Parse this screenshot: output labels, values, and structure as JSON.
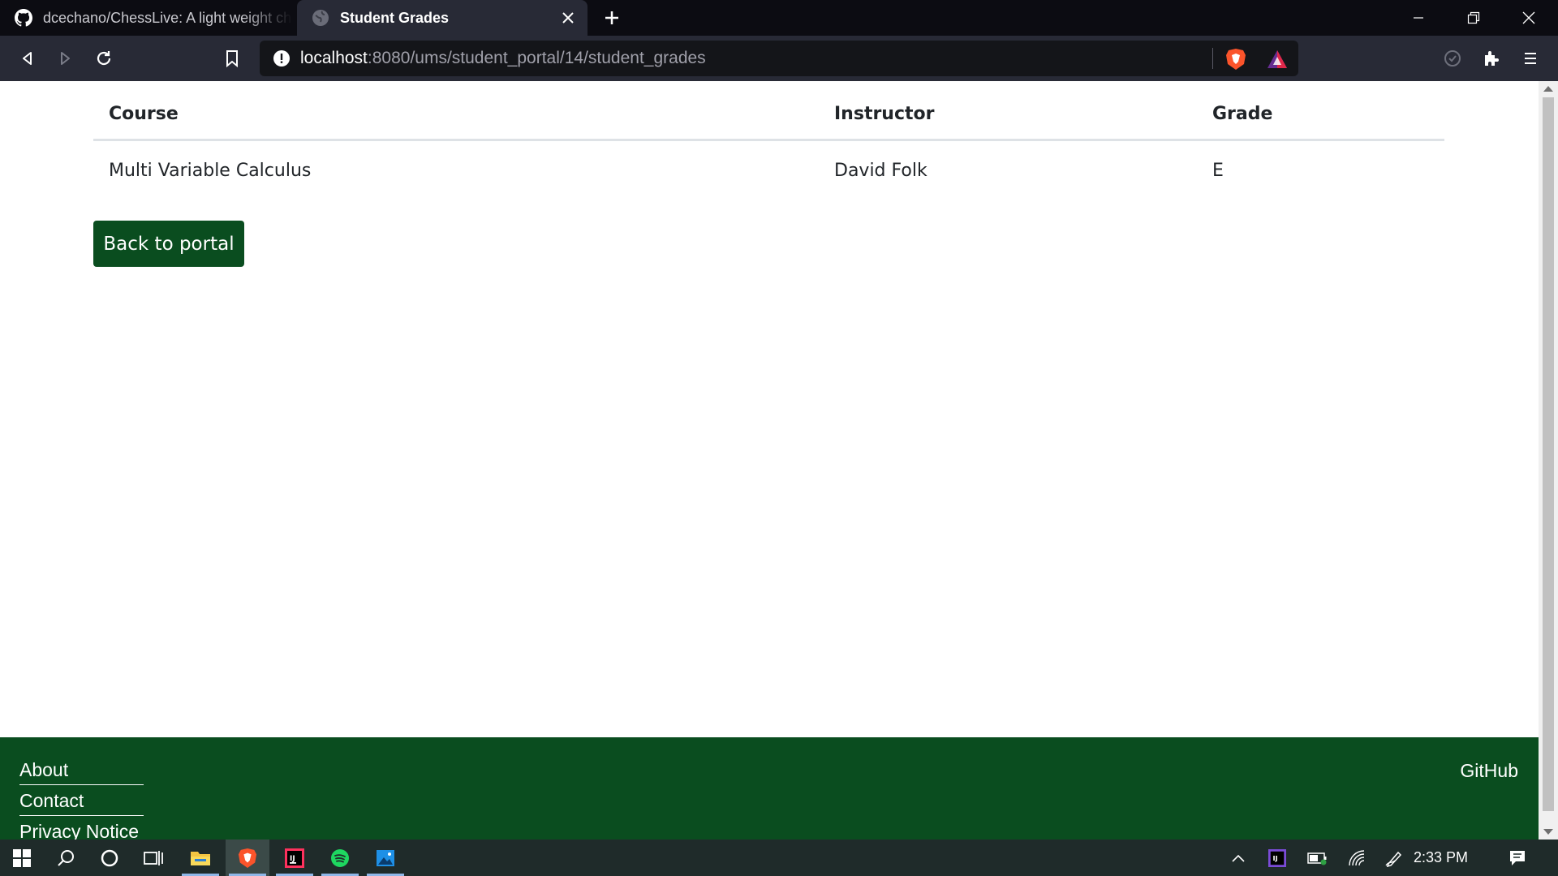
{
  "browser": {
    "tabs": [
      {
        "title": "dcechano/ChessLive: A light weight chess"
      },
      {
        "title": "Student Grades"
      }
    ],
    "url": {
      "host": "localhost",
      "path": ":8080/ums/student_portal/14/student_grades"
    }
  },
  "grades_table": {
    "headers": [
      "Course",
      "Instructor",
      "Grade"
    ],
    "rows": [
      {
        "course": "Multi Variable Calculus",
        "instructor": "David Folk",
        "grade": "E"
      }
    ]
  },
  "back_button": {
    "label": "Back to portal"
  },
  "footer": {
    "links": [
      "About",
      "Contact",
      "Privacy Notice"
    ],
    "github": "GitHub"
  },
  "taskbar": {
    "clock": "2:33 PM"
  },
  "colors": {
    "brand_green": "#0a4d1f",
    "tab_strip": "#0c0c12",
    "toolbar": "#282a36"
  }
}
